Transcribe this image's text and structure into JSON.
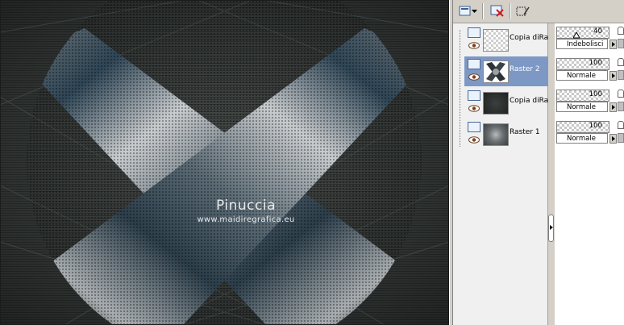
{
  "canvas": {
    "watermark_name": "Pinuccia",
    "watermark_url": "www.maidiregrafica.eu"
  },
  "layers_palette": {
    "toolbar": [
      {
        "name": "new-layer-icon"
      },
      {
        "name": "dropdown-arrow-icon"
      },
      {
        "name": "delete-layer-icon"
      },
      {
        "name": "edit-selection-icon"
      }
    ],
    "layers": [
      {
        "name": "Copia diRa",
        "opacity": "40",
        "blend": "Indebolisci",
        "selected": false
      },
      {
        "name": "Raster 2",
        "opacity": "100",
        "blend": "Normale",
        "selected": true
      },
      {
        "name": "Copia diRa",
        "opacity": "100",
        "blend": "Normale",
        "selected": false
      },
      {
        "name": "Raster 1",
        "opacity": "100",
        "blend": "Normale",
        "selected": false
      }
    ]
  },
  "colors": {
    "selection": "#7d98c4",
    "background_dark": "#2c302f",
    "accent_blue": "#3f5768"
  }
}
